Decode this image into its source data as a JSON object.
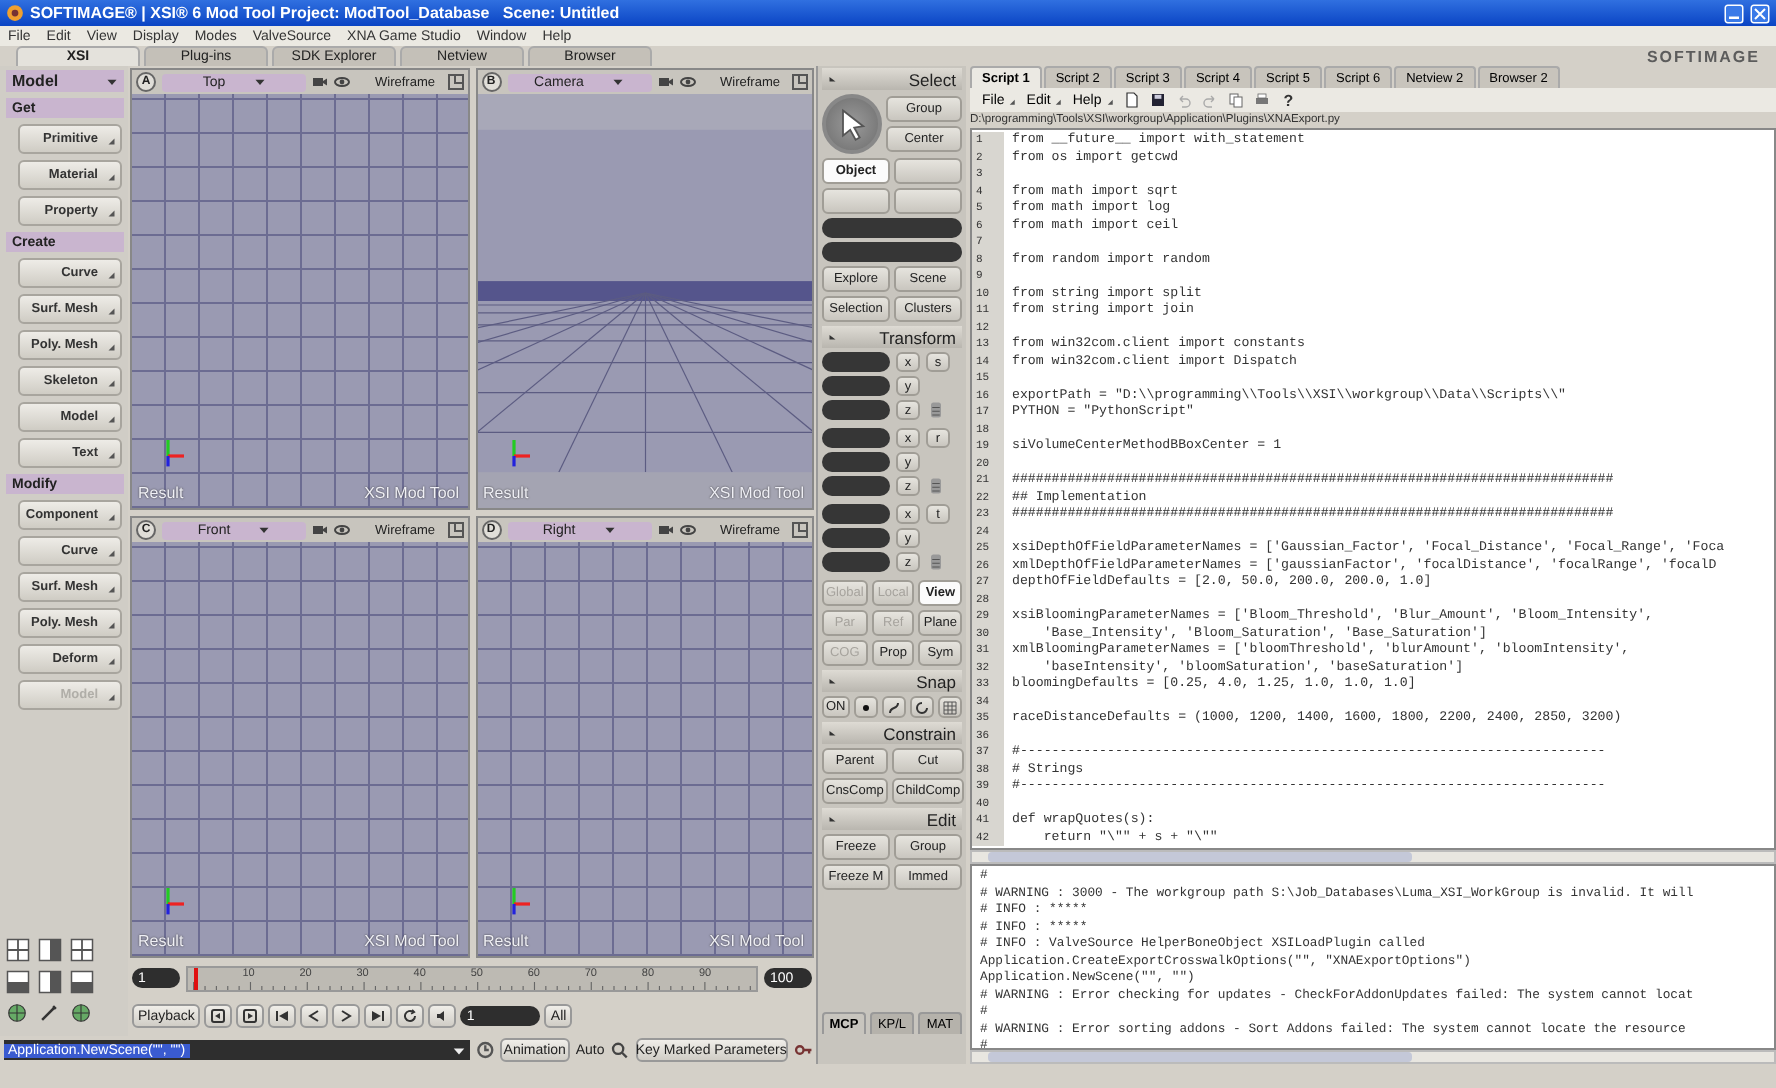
{
  "window": {
    "title": "SOFTIMAGE® | XSI® 6 Mod Tool Project: ModTool_Database   Scene: Untitled"
  },
  "menu": [
    "File",
    "Edit",
    "View",
    "Display",
    "Modes",
    "ValveSource",
    "XNA Game Studio",
    "Window",
    "Help"
  ],
  "main_tabs": [
    {
      "label": "XSI",
      "selected": true
    },
    {
      "label": "Plug-ins",
      "selected": false
    },
    {
      "label": "SDK Explorer",
      "selected": false
    },
    {
      "label": "Netview",
      "selected": false
    },
    {
      "label": "Browser",
      "selected": false
    }
  ],
  "logo_text": "SOFTIMAGE",
  "left_panel": {
    "mode": "Model",
    "sections": [
      {
        "title": "Get",
        "items": [
          {
            "label": "Primitive",
            "disabled": false
          },
          {
            "label": "Material",
            "disabled": false
          },
          {
            "label": "Property",
            "disabled": false
          }
        ]
      },
      {
        "title": "Create",
        "items": [
          {
            "label": "Curve",
            "disabled": false
          },
          {
            "label": "Surf. Mesh",
            "disabled": false
          },
          {
            "label": "Poly. Mesh",
            "disabled": false
          },
          {
            "label": "Skeleton",
            "disabled": false
          },
          {
            "label": "Model",
            "disabled": false
          },
          {
            "label": "Text",
            "disabled": false
          }
        ]
      },
      {
        "title": "Modify",
        "items": [
          {
            "label": "Component",
            "disabled": false
          },
          {
            "label": "Curve",
            "disabled": false
          },
          {
            "label": "Surf. Mesh",
            "disabled": false
          },
          {
            "label": "Poly. Mesh",
            "disabled": false
          },
          {
            "label": "Deform",
            "disabled": false
          },
          {
            "label": "Model",
            "disabled": true
          }
        ]
      }
    ]
  },
  "viewports": [
    {
      "letter": "A",
      "view": "Top",
      "display": "Wireframe",
      "kind": "ortho",
      "result": "Result",
      "footer": "XSI Mod Tool"
    },
    {
      "letter": "B",
      "view": "Camera",
      "display": "Wireframe",
      "kind": "perspective",
      "result": "Result",
      "footer": "XSI Mod Tool"
    },
    {
      "letter": "C",
      "view": "Front",
      "display": "Wireframe",
      "kind": "ortho",
      "result": "Result",
      "footer": "XSI Mod Tool"
    },
    {
      "letter": "D",
      "view": "Right",
      "display": "Wireframe",
      "kind": "ortho",
      "result": "Result",
      "footer": "XSI Mod Tool"
    }
  ],
  "timeline": {
    "start": "1",
    "end": "100",
    "labels": [
      "10",
      "20",
      "30",
      "40",
      "50",
      "60",
      "70",
      "80",
      "90"
    ],
    "playhead": {
      "level": 0.01
    },
    "playback_label": "Playback",
    "frame": "1",
    "range": "All"
  },
  "command_bar": {
    "command": "Application.NewScene(\"\", \"\")",
    "animation": "Animation",
    "auto": "Auto",
    "key_button": "Key Marked Parameters"
  },
  "tool_panel": {
    "select": {
      "title": "Select",
      "buttons": [
        {
          "label": "Group",
          "selected": false
        },
        {
          "label": "Center",
          "selected": false
        },
        {
          "label": "Object",
          "selected": true
        }
      ],
      "links": [
        "Explore",
        "Scene",
        "Selection",
        "Clusters"
      ]
    },
    "transform": {
      "title": "Transform",
      "groups": [
        {
          "mode": "s",
          "axes": [
            "x",
            "y",
            "z"
          ]
        },
        {
          "mode": "r",
          "axes": [
            "x",
            "y",
            "z"
          ]
        },
        {
          "mode": "t",
          "axes": [
            "x",
            "y",
            "z"
          ]
        }
      ],
      "options": [
        {
          "label": "Global",
          "selected": false,
          "disabled": true
        },
        {
          "label": "Local",
          "selected": false,
          "disabled": true
        },
        {
          "label": "View",
          "selected": true,
          "disabled": false
        },
        {
          "label": "Par",
          "selected": false,
          "disabled": true
        },
        {
          "label": "Ref",
          "selected": false,
          "disabled": true
        },
        {
          "label": "Plane",
          "selected": false,
          "disabled": false
        },
        {
          "label": "COG",
          "selected": false,
          "disabled": true
        },
        {
          "label": "Prop",
          "selected": false,
          "disabled": false
        },
        {
          "label": "Sym",
          "selected": false,
          "disabled": false
        }
      ]
    },
    "snap": {
      "title": "Snap",
      "toggle": "ON"
    },
    "constrain": {
      "title": "Constrain",
      "buttons": [
        "Parent",
        "Cut",
        "CnsComp",
        "ChildComp"
      ]
    },
    "edit": {
      "title": "Edit",
      "buttons": [
        "Freeze",
        "Group",
        "Freeze M",
        "Immed"
      ]
    },
    "tabs": [
      {
        "label": "MCP",
        "selected": true
      },
      {
        "label": "KP/L",
        "selected": false
      },
      {
        "label": "MAT",
        "selected": false
      }
    ]
  },
  "script_editor": {
    "tabs": [
      {
        "label": "Script 1",
        "selected": true
      },
      {
        "label": "Script 2",
        "selected": false
      },
      {
        "label": "Script 3",
        "selected": false
      },
      {
        "label": "Script 4",
        "selected": false
      },
      {
        "label": "Script 5",
        "selected": false
      },
      {
        "label": "Script 6",
        "selected": false
      },
      {
        "label": "Netview 2",
        "selected": false
      },
      {
        "label": "Browser 2",
        "selected": false
      }
    ],
    "menus": [
      "File",
      "Edit",
      "Help"
    ],
    "help_label": "?",
    "path": "D:\\programming\\Tools\\XSI\\workgroup\\Application\\Plugins\\XNAExport.py",
    "lines": [
      {
        "number": "1",
        "code": "from __future__ import with_statement"
      },
      {
        "number": "2",
        "code": "from os import getcwd"
      },
      {
        "number": "3"
      },
      {
        "number": "4",
        "code": "from math import sqrt"
      },
      {
        "number": "5",
        "code": "from math import log"
      },
      {
        "number": "6",
        "code": "from math import ceil"
      },
      {
        "number": "7"
      },
      {
        "number": "8",
        "code": "from random import random"
      },
      {
        "number": "9"
      },
      {
        "number": "10",
        "code": "from string import split"
      },
      {
        "number": "11",
        "code": "from string import join"
      },
      {
        "number": "12"
      },
      {
        "number": "13",
        "code": "from win32com.client import constants"
      },
      {
        "number": "14",
        "code": "from win32com.client import Dispatch"
      },
      {
        "number": "15"
      },
      {
        "number": "16",
        "code": "exportPath = \"D:\\\\programming\\\\Tools\\\\XSI\\\\workgroup\\\\Data\\\\Scripts\\\\\""
      },
      {
        "number": "17",
        "code": "PYTHON = \"PythonScript\""
      },
      {
        "number": "18"
      },
      {
        "number": "19",
        "code": "siVolumeCenterMethodBBoxCenter = 1"
      },
      {
        "number": "20"
      },
      {
        "number": "21",
        "code": "############################################################################"
      },
      {
        "number": "22",
        "code": "## Implementation"
      },
      {
        "number": "23",
        "code": "############################################################################"
      },
      {
        "number": "24"
      },
      {
        "number": "25",
        "code": "xsiDepthOfFieldParameterNames = ['Gaussian_Factor', 'Focal_Distance', 'Focal_Range', 'Foca"
      },
      {
        "number": "26",
        "code": "xmlDepthOfFieldParameterNames = ['gaussianFactor', 'focalDistance', 'focalRange', 'focalD"
      },
      {
        "number": "27",
        "code": "depthOfFieldDefaults = [2.0, 50.0, 200.0, 200.0, 1.0]"
      },
      {
        "number": "28"
      },
      {
        "number": "29",
        "code": "xsiBloomingParameterNames = ['Bloom_Threshold', 'Blur_Amount', 'Bloom_Intensity',"
      },
      {
        "number": "30",
        "code": "    'Base_Intensity', 'Bloom_Saturation', 'Base_Saturation']"
      },
      {
        "number": "31",
        "code": "xmlBloomingParameterNames = ['bloomThreshold', 'blurAmount', 'bloomIntensity',"
      },
      {
        "number": "32",
        "code": "    'baseIntensity', 'bloomSaturation', 'baseSaturation']"
      },
      {
        "number": "33",
        "code": "bloomingDefaults = [0.25, 4.0, 1.25, 1.0, 1.0, 1.0]"
      },
      {
        "number": "34"
      },
      {
        "number": "35",
        "code": "raceDistanceDefaults = (1000, 1200, 1400, 1600, 1800, 2200, 2400, 2850, 3200)"
      },
      {
        "number": "36"
      },
      {
        "number": "37",
        "code": "#--------------------------------------------------------------------------"
      },
      {
        "number": "38",
        "code": "# Strings"
      },
      {
        "number": "39",
        "code": "#--------------------------------------------------------------------------"
      },
      {
        "number": "40"
      },
      {
        "number": "41",
        "code": "def wrapQuotes(s):"
      },
      {
        "number": "42",
        "code": "    return \"\\\"\" + s + \"\\\"\""
      }
    ],
    "log": [
      "#",
      "# WARNING : 3000 - The workgroup path S:\\Job_Databases\\Luma_XSI_WorkGroup is invalid. It will",
      "# INFO : *****",
      "# INFO : *****",
      "# INFO : ValveSource HelperBoneObject XSILoadPlugin called",
      "Application.CreateExportCrosswalkOptions(\"\", \"XNAExportOptions\")",
      "Application.NewScene(\"\", \"\")",
      "# WARNING : Error checking for updates - CheckForAddonUpdates failed: The system cannot locat",
      "#",
      "# WARNING : Error sorting addons - Sort Addons failed: The system cannot locate the resource",
      "#"
    ]
  }
}
